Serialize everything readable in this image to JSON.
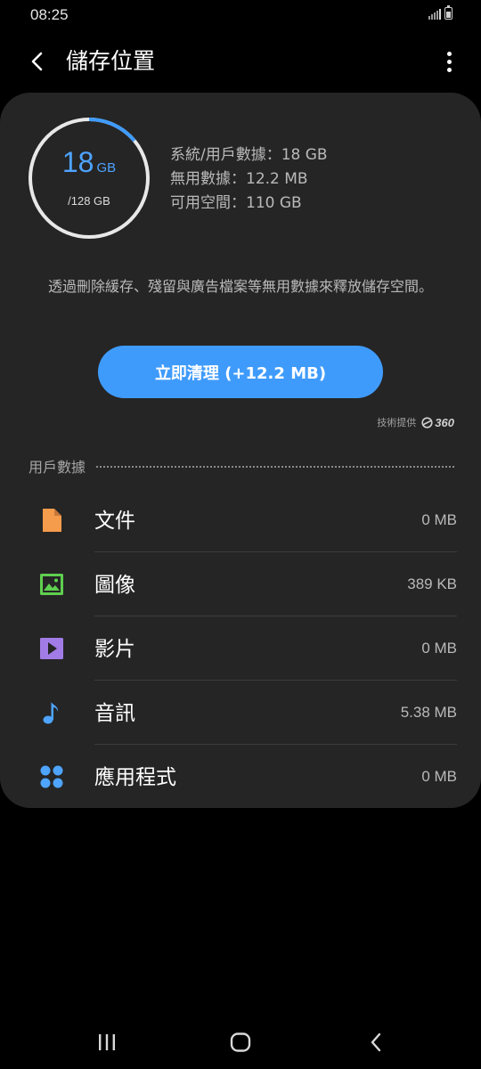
{
  "status_bar": {
    "time": "08:25"
  },
  "header": {
    "title": "儲存位置"
  },
  "storage": {
    "used_value": "18",
    "used_unit": "GB",
    "total": "/128 GB",
    "used_fraction": 0.14,
    "stats": [
      "系統/用戶數據：18 GB",
      "無用數據：12.2 MB",
      "可用空間：110 GB"
    ]
  },
  "description": "透過刪除緩存、殘留與廣告檔案等無用數據來釋放儲存空間。",
  "clean_button": {
    "label": "立即清理 (+12.2 MB)"
  },
  "provider": {
    "label": "技術提供",
    "brand": "360"
  },
  "user_data": {
    "title": "用戶數據",
    "items": [
      {
        "icon": "document-icon",
        "label": "文件",
        "size": "0 MB",
        "color": "#f59b4c"
      },
      {
        "icon": "image-icon",
        "label": "圖像",
        "size": "389 KB",
        "color": "#5fcf4f"
      },
      {
        "icon": "video-icon",
        "label": "影片",
        "size": "0 MB",
        "color": "#a27ce6"
      },
      {
        "icon": "music-note-icon",
        "label": "音訊",
        "size": "5.38 MB",
        "color": "#4ea4ff"
      },
      {
        "icon": "apps-icon",
        "label": "應用程式",
        "size": "0 MB",
        "color": "#4ea4ff"
      }
    ]
  },
  "colors": {
    "accent": "#3f9bfb",
    "ring_track": "#e8e8e8",
    "card_bg": "#252525"
  }
}
